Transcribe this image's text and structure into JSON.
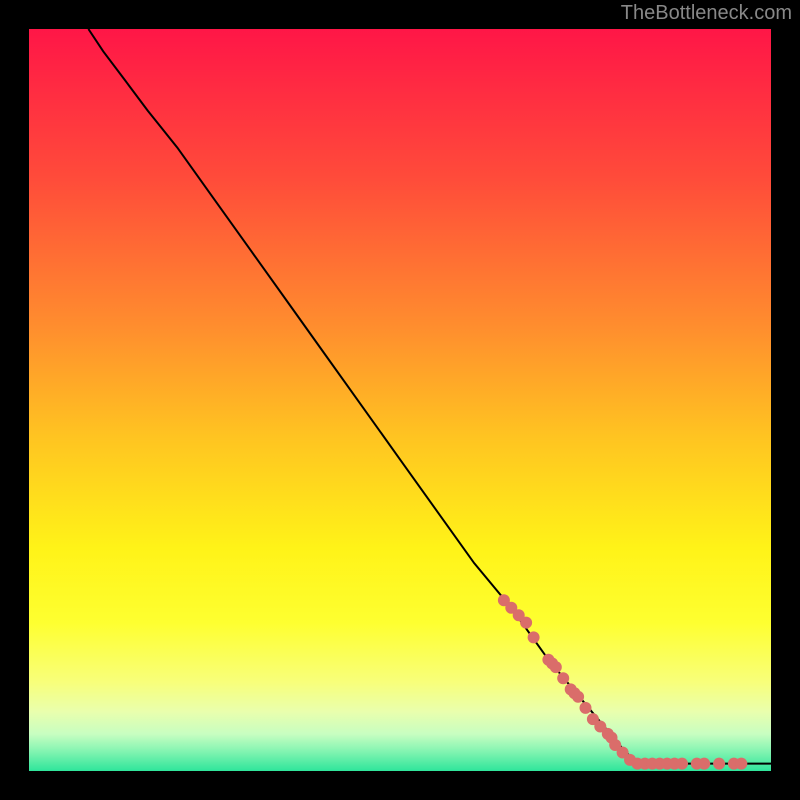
{
  "watermark": "TheBottleneck.com",
  "chart_data": {
    "type": "line",
    "title": "",
    "xlabel": "",
    "ylabel": "",
    "xlim": [
      0,
      100
    ],
    "ylim": [
      0,
      100
    ],
    "curve": {
      "points_xy": [
        [
          8,
          100
        ],
        [
          10,
          97
        ],
        [
          13,
          93
        ],
        [
          16,
          89
        ],
        [
          20,
          84
        ],
        [
          25,
          77
        ],
        [
          30,
          70
        ],
        [
          35,
          63
        ],
        [
          40,
          56
        ],
        [
          45,
          49
        ],
        [
          50,
          42
        ],
        [
          55,
          35
        ],
        [
          60,
          28
        ],
        [
          65,
          22
        ],
        [
          70,
          15
        ],
        [
          75,
          9
        ],
        [
          80,
          3
        ],
        [
          82,
          1
        ],
        [
          84,
          1
        ],
        [
          88,
          1
        ],
        [
          92,
          1
        ],
        [
          95,
          1
        ],
        [
          100,
          1
        ]
      ]
    },
    "markers": {
      "color": "#da6d6a",
      "radius": 6,
      "points_xy": [
        [
          64,
          23
        ],
        [
          65,
          22
        ],
        [
          66,
          21
        ],
        [
          67,
          20
        ],
        [
          68,
          18
        ],
        [
          70,
          15
        ],
        [
          70.5,
          14.5
        ],
        [
          71,
          14
        ],
        [
          72,
          12.5
        ],
        [
          73,
          11
        ],
        [
          73.5,
          10.5
        ],
        [
          74,
          10
        ],
        [
          75,
          8.5
        ],
        [
          76,
          7
        ],
        [
          77,
          6
        ],
        [
          78,
          5
        ],
        [
          78.5,
          4.5
        ],
        [
          79,
          3.5
        ],
        [
          80,
          2.5
        ],
        [
          81,
          1.5
        ],
        [
          82,
          1
        ],
        [
          83,
          1
        ],
        [
          84,
          1
        ],
        [
          85,
          1
        ],
        [
          86,
          1
        ],
        [
          87,
          1
        ],
        [
          88,
          1
        ],
        [
          90,
          1
        ],
        [
          91,
          1
        ],
        [
          93,
          1
        ],
        [
          95,
          1
        ],
        [
          96,
          1
        ]
      ]
    },
    "gradient_stops": [
      {
        "offset": 0,
        "color": "#ff1647"
      },
      {
        "offset": 20,
        "color": "#ff4b3a"
      },
      {
        "offset": 40,
        "color": "#ff8d2e"
      },
      {
        "offset": 55,
        "color": "#ffc421"
      },
      {
        "offset": 70,
        "color": "#fff318"
      },
      {
        "offset": 80,
        "color": "#feff30"
      },
      {
        "offset": 88,
        "color": "#f8ff7a"
      },
      {
        "offset": 92,
        "color": "#e9ffad"
      },
      {
        "offset": 95,
        "color": "#c8fec1"
      },
      {
        "offset": 97,
        "color": "#8ef6b4"
      },
      {
        "offset": 100,
        "color": "#2fe59b"
      }
    ]
  }
}
